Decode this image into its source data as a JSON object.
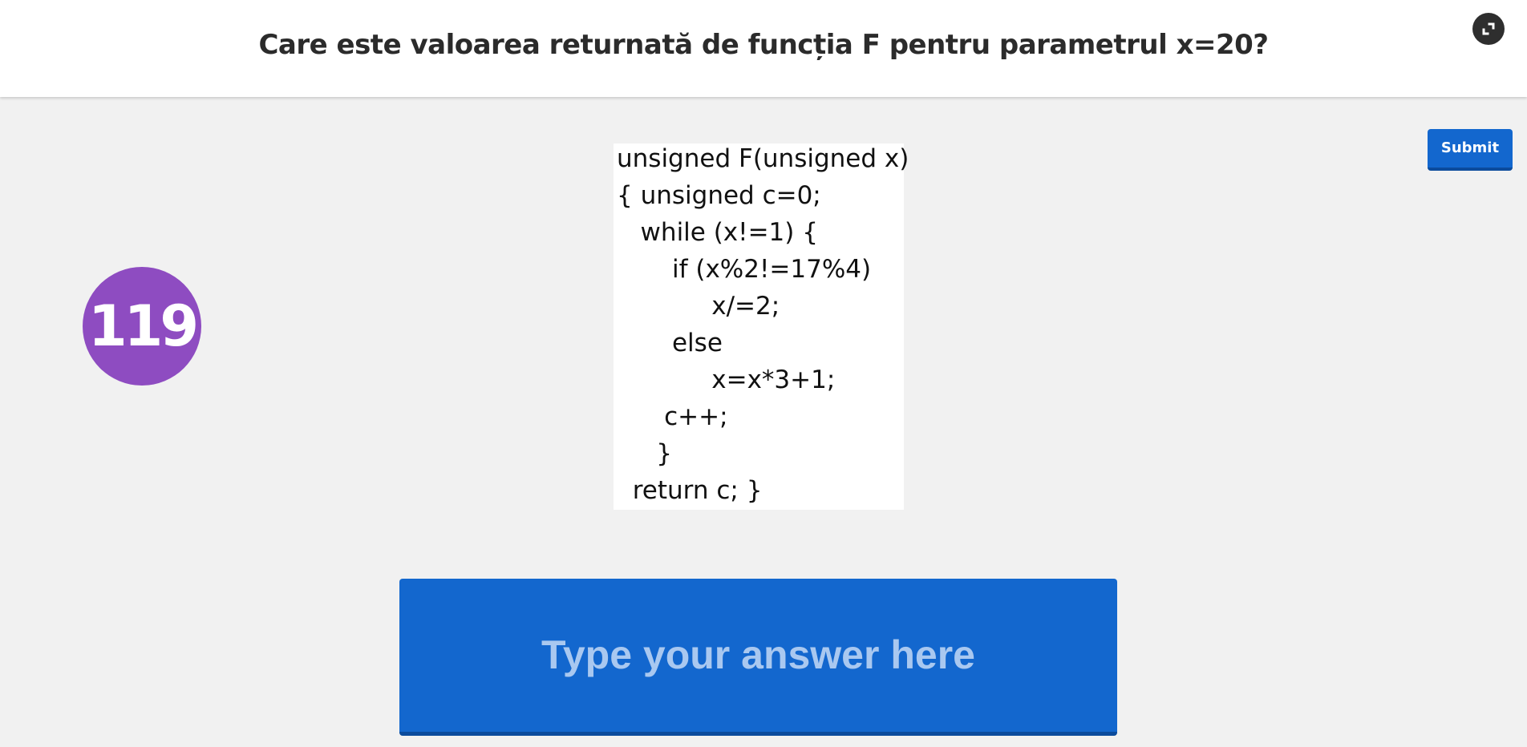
{
  "header": {
    "question": "Care este valoarea returnată de funcția F pentru parametrul x=20?",
    "fullscreen_icon": "exit-fullscreen-icon"
  },
  "toolbar": {
    "submit_label": "Submit"
  },
  "question_number": "119",
  "code": {
    "lines": [
      "unsigned F(unsigned x)",
      "{ unsigned c=0;",
      "   while (x!=1) {",
      "       if (x%2!=17%4)",
      "            x/=2;",
      "       else",
      "            x=x*3+1;",
      "      c++;",
      "     }",
      "  return c; }"
    ]
  },
  "answer": {
    "placeholder": "Type your answer here",
    "value": ""
  },
  "colors": {
    "accent": "#1367ce",
    "badge": "#8e4cc1",
    "background": "#f1f1f1"
  }
}
